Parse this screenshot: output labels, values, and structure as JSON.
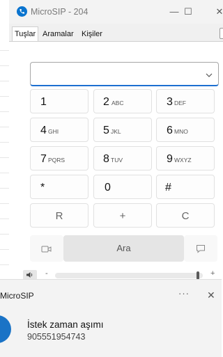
{
  "window": {
    "title": "MicroSIP - 204",
    "minimize_glyph": "—",
    "maximize_glyph": "☐",
    "close_glyph": "✕"
  },
  "tabs": [
    {
      "label": "Tuşlar",
      "active": true
    },
    {
      "label": "Aramalar",
      "active": false
    },
    {
      "label": "Kişiler",
      "active": false
    }
  ],
  "dial_input": {
    "value": "",
    "placeholder": ""
  },
  "keypad": [
    {
      "digit": "1",
      "letters": ""
    },
    {
      "digit": "2",
      "letters": "ABC"
    },
    {
      "digit": "3",
      "letters": "DEF"
    },
    {
      "digit": "4",
      "letters": "GHI"
    },
    {
      "digit": "5",
      "letters": "JKL"
    },
    {
      "digit": "6",
      "letters": "MNO"
    },
    {
      "digit": "7",
      "letters": "PQRS"
    },
    {
      "digit": "8",
      "letters": "TUV"
    },
    {
      "digit": "9",
      "letters": "WXYZ"
    },
    {
      "digit": "*",
      "letters": ""
    },
    {
      "digit": "0",
      "letters": ""
    },
    {
      "digit": "#",
      "letters": ""
    }
  ],
  "function_keys": [
    "R",
    "+",
    "C"
  ],
  "call": {
    "button_label": "Ara",
    "left_icon": "video-call-icon",
    "right_icon": "message-icon"
  },
  "volume": {
    "minus_label": "-",
    "plus_label": "+",
    "level": 0.96
  },
  "notification": {
    "app_name": "MicroSIP",
    "more_glyph": "···",
    "close_glyph": "✕",
    "title": "İstek zaman aşımı",
    "body": "905551954743"
  },
  "colors": {
    "accent": "#0a74cf",
    "focus_underline": "#1c6fd0"
  }
}
